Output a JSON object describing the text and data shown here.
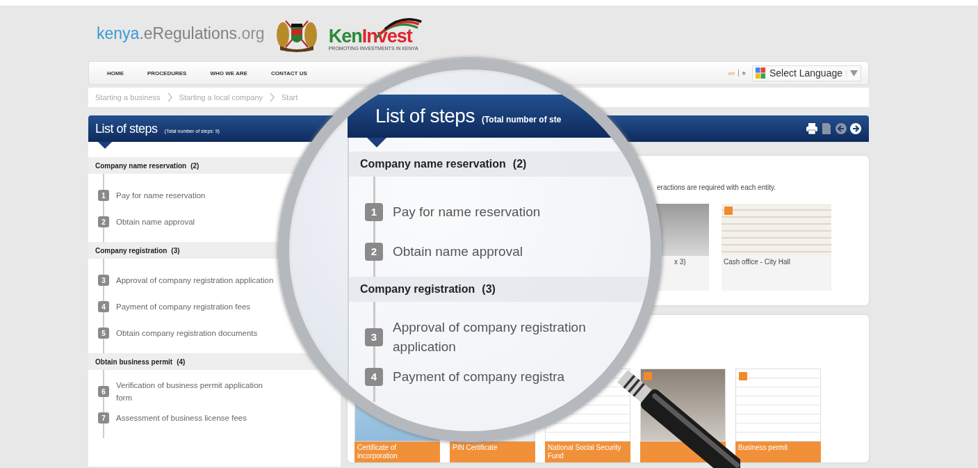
{
  "header": {
    "site_logo": [
      "kenya",
      ".eRegulations",
      ".org"
    ],
    "partner_logo": {
      "name": [
        "Ken",
        "Invest"
      ],
      "tagline": "PROMOTING INVESTMENTS IN KENYA"
    }
  },
  "nav": {
    "items": [
      {
        "label": "HOME"
      },
      {
        "label": "PROCEDURES"
      },
      {
        "label": "WHO WE ARE"
      },
      {
        "label": "CONTACT US"
      }
    ],
    "languages": [
      {
        "label": "en",
        "selected": true
      },
      {
        "label": "fr",
        "selected": false
      }
    ],
    "language_select": {
      "value": "Select Language"
    }
  },
  "breadcrumb": [
    "Starting a business",
    "Starting a local company",
    "Start"
  ],
  "steps_bar": {
    "title": "List of steps",
    "subtitle": "(Total number of steps: 9)",
    "tools": [
      {
        "kind": "print",
        "disabled": false
      },
      {
        "kind": "document",
        "disabled": true
      },
      {
        "kind": "back",
        "disabled": true
      },
      {
        "kind": "forward",
        "disabled": false
      }
    ]
  },
  "sections": [
    {
      "title": "Company name reservation",
      "count": "(2)",
      "steps": [
        {
          "number": "1",
          "label": "Pay for name reservation"
        },
        {
          "number": "2",
          "label": "Obtain name approval"
        }
      ]
    },
    {
      "title": "Company registration",
      "count": "(3)",
      "steps": [
        {
          "number": "3",
          "label": "Approval of company registration application"
        },
        {
          "number": "4",
          "label": "Payment of company registration fees"
        },
        {
          "number": "5",
          "label": "Obtain company registration documents"
        }
      ]
    },
    {
      "title": "Obtain business permit",
      "count": "(4)",
      "steps": [
        {
          "number": "6",
          "label": "Verification of business permit application form"
        },
        {
          "number": "7",
          "label": "Assessment of business license fees"
        }
      ]
    }
  ],
  "entities_card": {
    "text": "eractions are required with each entity.",
    "photos": [
      {
        "caption": "x 3)"
      },
      {
        "caption": "Cash office - City Hall",
        "badge": true
      }
    ]
  },
  "documents_card": {
    "thumbnails": [
      {
        "kind": "form",
        "caption": "Certificate of incorporation"
      },
      {
        "kind": "paper",
        "caption": "PIN Certificate"
      },
      {
        "kind": "form",
        "caption": "National Social Security Fund"
      },
      {
        "kind": "photo",
        "badge": true
      },
      {
        "kind": "form",
        "caption": "Business permit",
        "badge": true
      }
    ]
  },
  "magnifier": {
    "title": "List of steps",
    "subtitle": "(Total number of ste",
    "sections": [
      {
        "title": "Company name reservation",
        "count": "(2)",
        "steps": [
          {
            "number": "1",
            "label": "Pay for name reservation"
          },
          {
            "number": "2",
            "label": "Obtain name approval"
          }
        ]
      },
      {
        "title": "Company registration",
        "count": "(3)",
        "steps": [
          {
            "number": "3",
            "label": "Approval of company registration application"
          },
          {
            "number": "4",
            "label": "Payment of company registra"
          }
        ]
      }
    ]
  }
}
